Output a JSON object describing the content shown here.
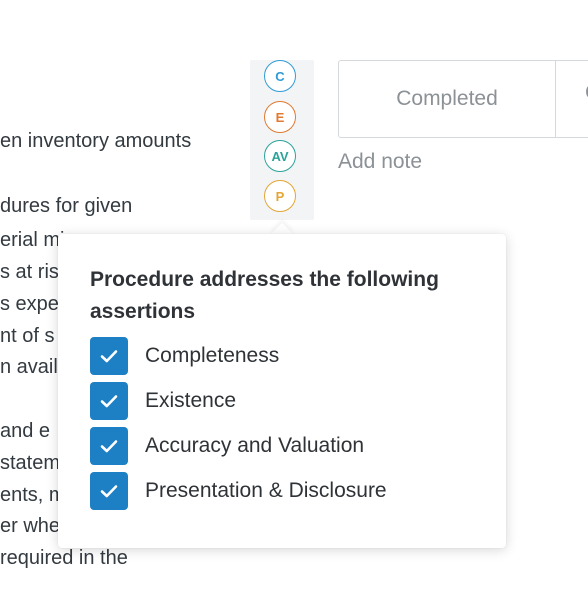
{
  "background_text": [
    "en inventory amounts",
    "dures for given",
    "erial mi",
    "s at risl",
    "s expe",
    "nt of s",
    "n availa",
    "and e",
    "statem",
    "ents, m",
    "er whe",
    " required in the"
  ],
  "assertion_badges": [
    {
      "letter": "C",
      "color": "#2f9bd6"
    },
    {
      "letter": "E",
      "color": "#e07a33"
    },
    {
      "letter": "AV",
      "color": "#2ba39a"
    },
    {
      "letter": "P",
      "color": "#e3a635"
    }
  ],
  "status": {
    "value": "Completed",
    "next_partial": "C"
  },
  "add_note_label": "Add note",
  "popover": {
    "title": "Procedure addresses the following assertions",
    "options": [
      {
        "label": "Completeness",
        "checked": true
      },
      {
        "label": "Existence",
        "checked": true
      },
      {
        "label": "Accuracy and Valuation",
        "checked": true
      },
      {
        "label": "Presentation & Disclosure",
        "checked": true
      }
    ]
  },
  "colors": {
    "checkbox": "#1d7fc4",
    "muted_text": "#8c9196"
  }
}
